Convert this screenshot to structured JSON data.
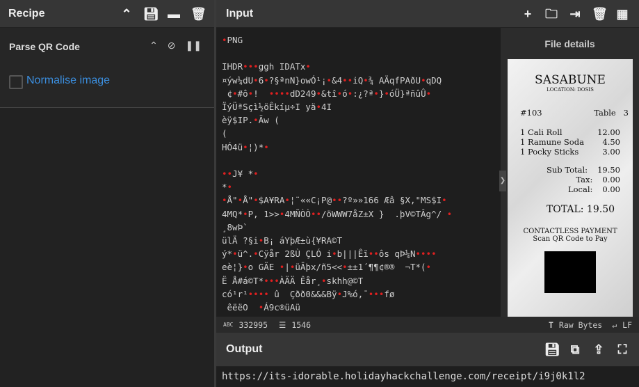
{
  "recipe": {
    "title": "Recipe",
    "operation": {
      "name": "Parse QR Code",
      "option_label": "Normalise image",
      "checked": false
    }
  },
  "input": {
    "title": "Input",
    "lines": [
      "•PNG",
      "",
      "IHDR•••ggh IDATx•",
      "¤ýw¼dU•6•?§ªnN}owÓ¹¡•&4••iQ•¾ AÄqfPAðU•qDQ",
      " ¢•#ô•!  ••••dD249•&tî•ó•:¿?ª•}•óÜ}ªñûÛ•",
      "ÏýÜªSçì½öÊkíµ÷I yä•4I",
      "èÿ$IP.•Āw (",
      "(",
      "HÓ4ü•¦)*•",
      "",
      "••J¥ *•",
      "*•",
      "•Å\"•Å\"•$A¥RA•¦¨««C¡P@••?º»»166 Æâ §X,\"MS$I•",
      "4MQ*•P, 1>>•4MÑÒÒ••/öWWW7åZ±X }  .þV©TÂg^/ • ",
      "¸8wÞ`",
      "ülÄ ?§i•B¡ áYþÆ±ù{¥RA©T",
      "ý*•ü^.•Cÿår 2ßÙ ÇLÓ i•b|||Êï••ôs qÞ¼N••••",
      "eè¦}•o GÄE •|•üĀþx/ñ5<<•±±1´¶¶¢®®  ¬T*(•",
      "Ë Å#á©T*•••ÀÄÄ Êår¸•skhh@©T",
      "có¹r¹•••• û  Çðð0&&&Bÿ•J%ó,¯•••fø",
      " êëëO  •Á9c®üAü"
    ],
    "length": "332995",
    "lines_count": "1546",
    "raw_bytes": "Raw Bytes",
    "eol": "LF"
  },
  "file_details": {
    "title": "File details",
    "receipt": {
      "name": "SASABUNE",
      "location": "LOCATION: DOSIS",
      "order": "#103",
      "table": "Table   3",
      "items": [
        [
          "1 Cali Roll",
          "12.00"
        ],
        [
          "1 Ramune Soda",
          "4.50"
        ],
        [
          "1 Pocky Sticks",
          "3.00"
        ]
      ],
      "totals": [
        [
          "Sub Total:",
          "19.50"
        ],
        [
          "Tax:",
          "0.00"
        ],
        [
          "Local:",
          "0.00"
        ]
      ],
      "total": "TOTAL: 19.50",
      "pay1": "CONTACTLESS PAYMENT",
      "pay2": "Scan QR Code to Pay"
    }
  },
  "output": {
    "title": "Output",
    "value": "https://its-idorable.holidayhackchallenge.com/receipt/i9j0k1l2"
  }
}
